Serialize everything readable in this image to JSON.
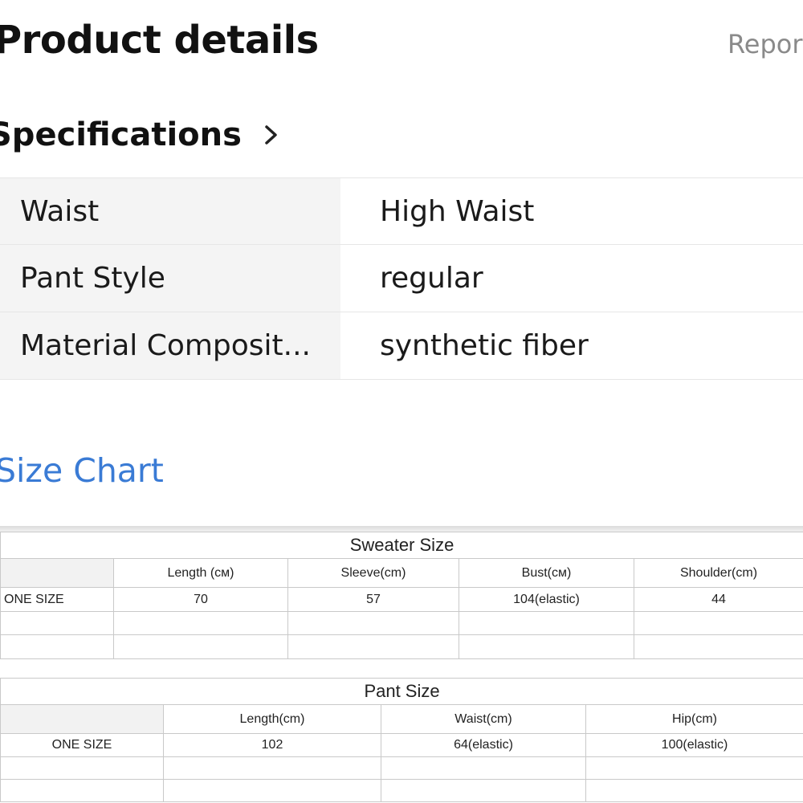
{
  "header": {
    "title": "Product details",
    "report_label": "Repor"
  },
  "specifications": {
    "title": "Specifications",
    "rows": [
      {
        "key": "Waist",
        "value": "High Waist"
      },
      {
        "key": "Pant Style",
        "value": "regular"
      },
      {
        "key": "Material Composit...",
        "value": "synthetic fiber"
      }
    ]
  },
  "size_chart": {
    "link_label": "Size Chart",
    "sweater": {
      "caption": "Sweater Size",
      "headers": [
        "",
        "Length (cм)",
        "Sleeve(cm)",
        "Bust(cм)",
        "Shoulder(cm)"
      ],
      "rows": [
        [
          "ONE SIZE",
          "70",
          "57",
          "104(elastic)",
          "44"
        ],
        [
          "",
          "",
          "",
          "",
          ""
        ],
        [
          "",
          "",
          "",
          "",
          ""
        ]
      ]
    },
    "pant": {
      "caption": "Pant Size",
      "headers": [
        "",
        "Length(cm)",
        "Waist(cm)",
        "Hip(cm)"
      ],
      "rows": [
        [
          "ONE SIZE",
          "102",
          "64(elastic)",
          "100(elastic)"
        ],
        [
          "",
          "",
          "",
          ""
        ],
        [
          "",
          "",
          "",
          ""
        ]
      ]
    }
  },
  "colors": {
    "link_blue": "#3a7bd5",
    "muted_gray": "#8a8a8a",
    "key_cell_bg": "#f4f4f4"
  }
}
